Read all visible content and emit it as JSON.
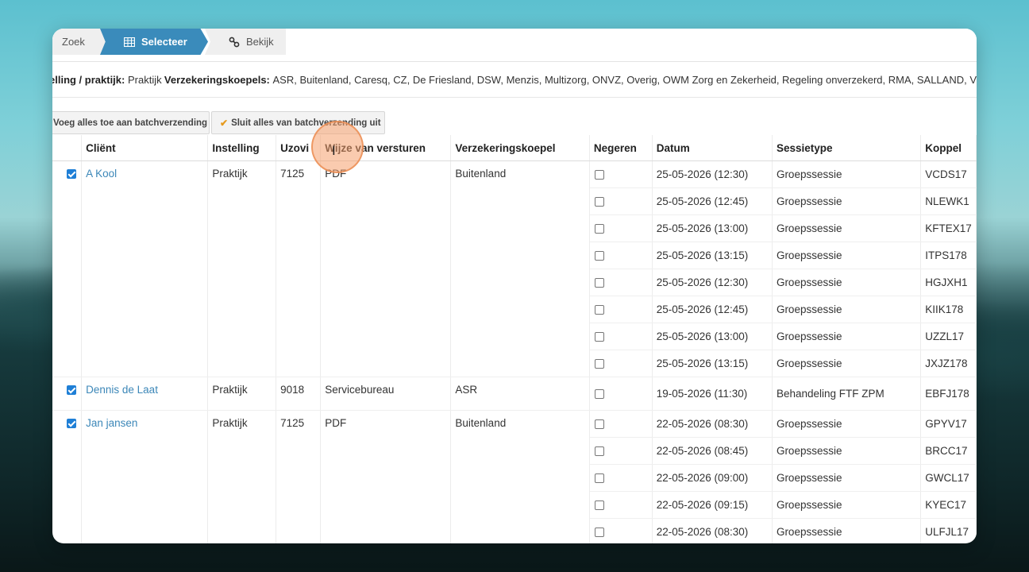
{
  "steps": [
    {
      "label": "Zoek",
      "icon": "chevron-left-icon"
    },
    {
      "label": "Selecteer",
      "icon": "table-icon"
    },
    {
      "label": "Bekijk",
      "icon": "link-icon"
    }
  ],
  "filters": {
    "instelling_label": "elling / praktijk:",
    "instelling_value": "Praktijk",
    "koepels_label": "Verzekeringskoepels:",
    "koepels_value": "ASR, Buitenland, Caresq, CZ, De Friesland, DSW, Menzis, Multizorg, ONVZ, Overig, OWM Zorg en Zekerheid, Regeling onverzekerd, RMA, SALLAND, V"
  },
  "toolbar": {
    "add_all": "Voeg alles toe aan batchverzending",
    "exclude_all": "Sluit alles van batchverzending uit"
  },
  "columns": [
    "Cliënt",
    "Instelling",
    "Uzovi",
    "Wijze van versturen",
    "Verzekeringskoepel",
    "Negeren",
    "Datum",
    "Sessietype",
    "Koppel"
  ],
  "groups": [
    {
      "selected": true,
      "client": "A Kool",
      "instelling": "Praktijk",
      "uzovi": "7125",
      "wijze": "PDF",
      "koepel": "Buitenland",
      "rows": [
        {
          "datum": "25-05-2026 (12:30)",
          "sessietype": "Groepssessie",
          "koppel": "VCDS17"
        },
        {
          "datum": "25-05-2026 (12:45)",
          "sessietype": "Groepssessie",
          "koppel": "NLEWK1"
        },
        {
          "datum": "25-05-2026 (13:00)",
          "sessietype": "Groepssessie",
          "koppel": "KFTEX17"
        },
        {
          "datum": "25-05-2026 (13:15)",
          "sessietype": "Groepssessie",
          "koppel": "ITPS178"
        },
        {
          "datum": "25-05-2026 (12:30)",
          "sessietype": "Groepssessie",
          "koppel": "HGJXH1"
        },
        {
          "datum": "25-05-2026 (12:45)",
          "sessietype": "Groepssessie",
          "koppel": "KIIK178"
        },
        {
          "datum": "25-05-2026 (13:00)",
          "sessietype": "Groepssessie",
          "koppel": "UZZL17"
        },
        {
          "datum": "25-05-2026 (13:15)",
          "sessietype": "Groepssessie",
          "koppel": "JXJZ178"
        }
      ]
    },
    {
      "selected": true,
      "client": "Dennis de Laat",
      "instelling": "Praktijk",
      "uzovi": "9018",
      "wijze": "Servicebureau",
      "koepel": "ASR",
      "rows": [
        {
          "datum": "19-05-2026 (11:30)",
          "sessietype": "Behandeling FTF ZPM",
          "koppel": "EBFJ178"
        }
      ]
    },
    {
      "selected": true,
      "client": "Jan jansen",
      "instelling": "Praktijk",
      "uzovi": "7125",
      "wijze": "PDF",
      "koepel": "Buitenland",
      "rows": [
        {
          "datum": "22-05-2026 (08:30)",
          "sessietype": "Groepssessie",
          "koppel": "GPYV17"
        },
        {
          "datum": "22-05-2026 (08:45)",
          "sessietype": "Groepssessie",
          "koppel": "BRCC17"
        },
        {
          "datum": "22-05-2026 (09:00)",
          "sessietype": "Groepssessie",
          "koppel": "GWCL17"
        },
        {
          "datum": "22-05-2026 (09:15)",
          "sessietype": "Groepssessie",
          "koppel": "KYEC17"
        },
        {
          "datum": "22-05-2026 (08:30)",
          "sessietype": "Groepssessie",
          "koppel": "ULFJL17"
        }
      ]
    }
  ],
  "colors": {
    "accent": "#3a8bbb",
    "link": "#3c87b8",
    "checkbox": "#1f7fd6",
    "check_icon": "#e69a1e"
  }
}
